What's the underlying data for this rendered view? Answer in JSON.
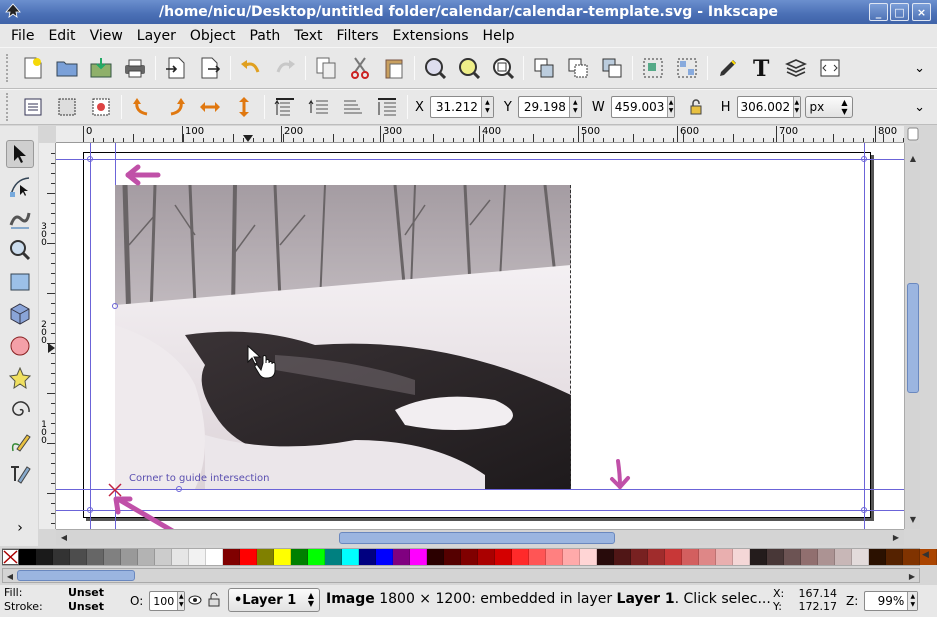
{
  "window": {
    "title": "/home/nicu/Desktop/untitled folder/calendar/calendar-template.svg - Inkscape",
    "buttons": {
      "minimize": "_",
      "maximize": "□",
      "close": "×"
    }
  },
  "menu": [
    "File",
    "Edit",
    "View",
    "Layer",
    "Object",
    "Path",
    "Text",
    "Filters",
    "Extensions",
    "Help"
  ],
  "command_bar": {
    "icons": [
      "new-document-icon",
      "open-icon",
      "save-icon",
      "print-icon",
      "import-icon",
      "export-icon",
      "undo-icon",
      "redo-icon",
      "copy-icon",
      "cut-icon",
      "paste-icon",
      "zoom-selection-icon",
      "zoom-drawing-icon",
      "zoom-page-icon",
      "duplicate-icon",
      "clone-icon",
      "unlink-clone-icon",
      "group-icon",
      "ungroup-icon",
      "fill-stroke-icon",
      "text-font-icon",
      "layers-icon",
      "xml-editor-icon"
    ]
  },
  "controls_bar": {
    "x_label": "X",
    "x_value": "31.212",
    "y_label": "Y",
    "y_value": "29.198",
    "w_label": "W",
    "w_value": "459.003",
    "h_label": "H",
    "h_value": "306.002",
    "unit": "px"
  },
  "rulers": {
    "horizontal": [
      "0",
      "100",
      "200",
      "300",
      "400",
      "500",
      "600",
      "700",
      "800"
    ],
    "vertical": [
      "300",
      "200",
      "100"
    ]
  },
  "canvas": {
    "snap_label": "Corner to guide intersection"
  },
  "palette": {
    "colors": [
      "#000000",
      "#1a1a1a",
      "#333333",
      "#4d4d4d",
      "#666666",
      "#808080",
      "#999999",
      "#b3b3b3",
      "#cccccc",
      "#e6e6e6",
      "#f2f2f2",
      "#ffffff",
      "#800000",
      "#ff0000",
      "#808000",
      "#ffff00",
      "#008000",
      "#00ff00",
      "#008080",
      "#00ffff",
      "#000080",
      "#0000ff",
      "#800080",
      "#ff00ff",
      "#2b0000",
      "#550000",
      "#800000",
      "#aa0000",
      "#d40000",
      "#ff2a2a",
      "#ff5555",
      "#ff8080",
      "#ffaaaa",
      "#ffd5d5",
      "#280b0b",
      "#501616",
      "#782121",
      "#a02c2c",
      "#c83737",
      "#d35f5f",
      "#de8787",
      "#e9afaf",
      "#f4d7d7",
      "#241c1c",
      "#483737",
      "#6c5353",
      "#916f6f",
      "#ac9393",
      "#c8b7b7",
      "#e3dbdb",
      "#2b1100",
      "#552200",
      "#803300",
      "#aa4400"
    ]
  },
  "status": {
    "fill_label": "Fill:",
    "fill_value": "Unset",
    "stroke_label": "Stroke:",
    "stroke_value": "Unset",
    "opacity_label": "O:",
    "opacity_value": "100",
    "layer": "•Layer 1",
    "message_prefix": "Image",
    "message_dims": " 1800 × 1200: embedded in layer ",
    "message_layer": "Layer 1",
    "message_suffix": ". Click selec...",
    "x_label": "X:",
    "x_value": "167.14",
    "y_label": "Y:",
    "y_value": "172.17",
    "zoom_label": "Z:",
    "zoom_value": "99%"
  }
}
